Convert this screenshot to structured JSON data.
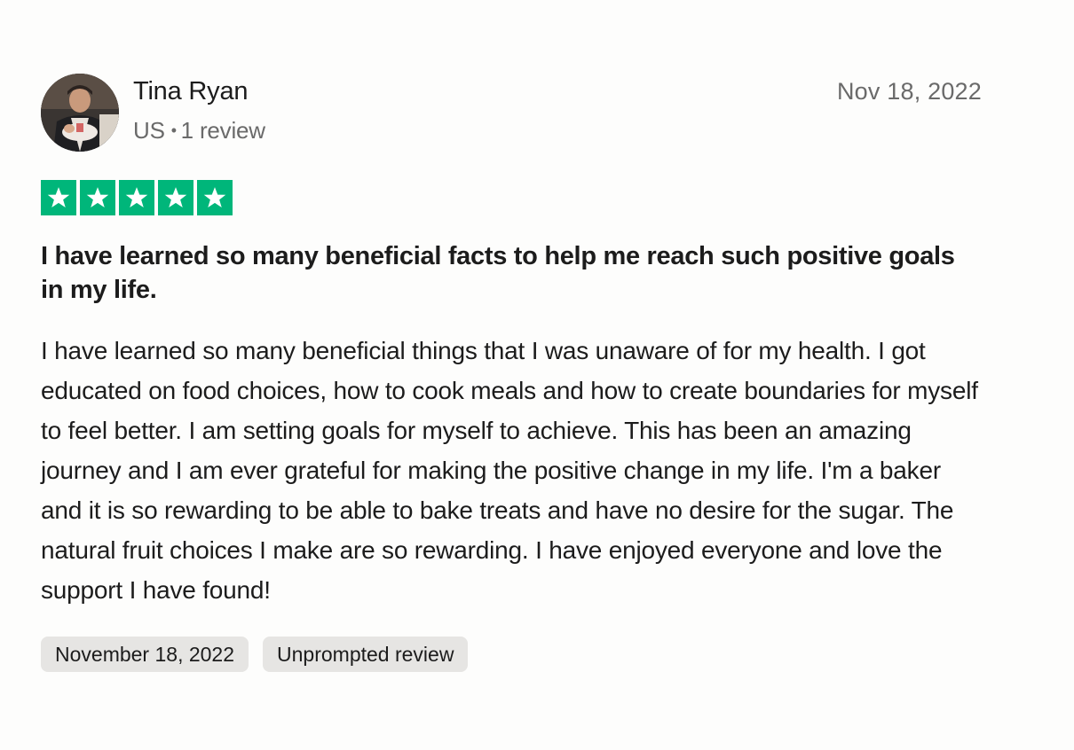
{
  "reviewer": {
    "name": "Tina Ryan",
    "country": "US",
    "separator": "•",
    "review_count": "1 review"
  },
  "review": {
    "date_short": "Nov 18, 2022",
    "rating": 5,
    "rating_max": 5,
    "title": "I have learned so many beneficial facts to help me reach such positive goals in my life.",
    "body": "I have learned so many beneficial things that I was unaware of for my health. I got educated on food choices, how to cook meals and how to create boundaries for myself to feel better. I am setting goals for myself to achieve. This has been an amazing journey and I am ever grateful for making the positive change in my life. I'm a baker and it is so rewarding to be able to bake treats and have no desire for the sugar. The natural fruit choices I make are so rewarding. I have enjoyed everyone and love the support I have found!",
    "tags": {
      "date_of_experience": "November 18, 2022",
      "review_type": "Unprompted review"
    }
  },
  "colors": {
    "star_green": "#00b67a",
    "tag_bg": "#e6e5e3",
    "muted_text": "#6a6a6a"
  },
  "icons": [
    "avatar-photo",
    "star-icon"
  ]
}
